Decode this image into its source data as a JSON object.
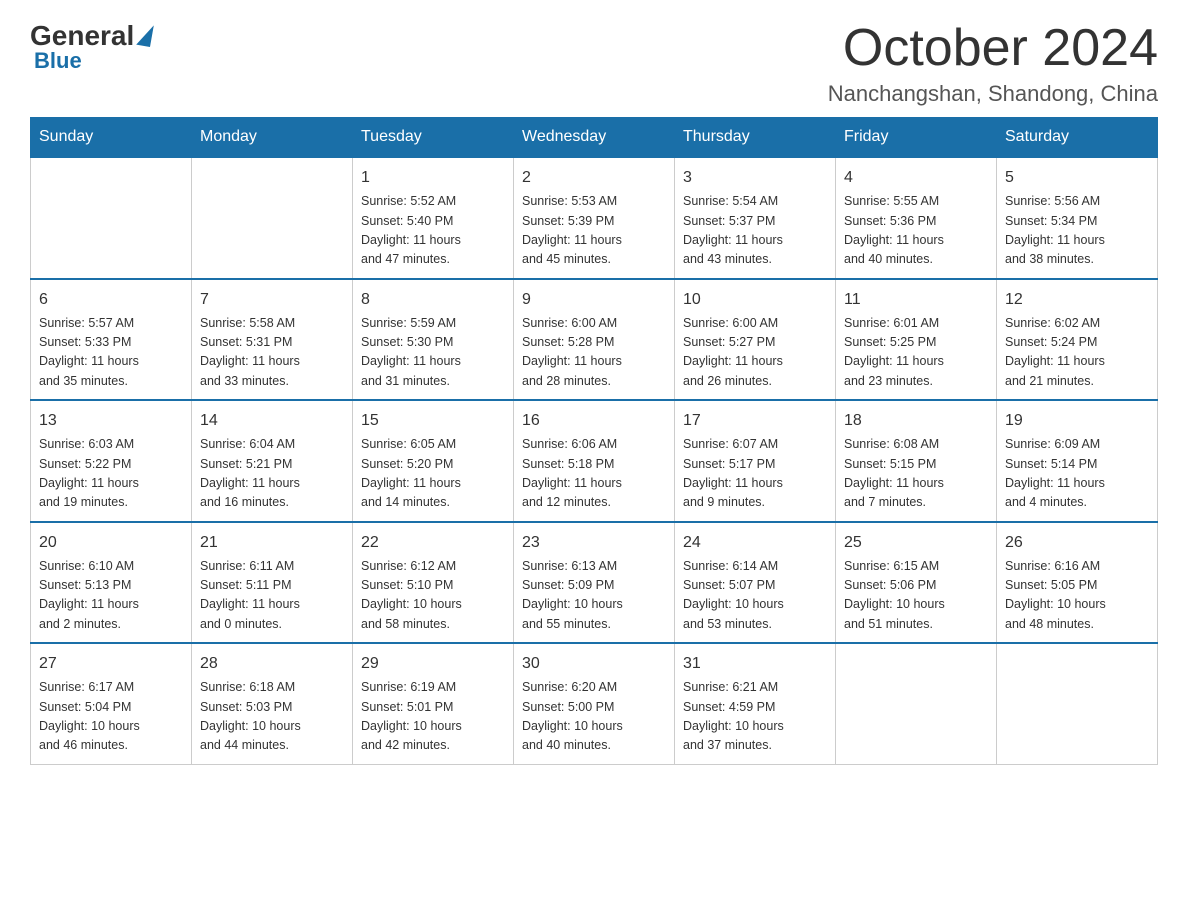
{
  "logo": {
    "general": "General",
    "blue": "Blue"
  },
  "title": "October 2024",
  "subtitle": "Nanchangshan, Shandong, China",
  "days": [
    "Sunday",
    "Monday",
    "Tuesday",
    "Wednesday",
    "Thursday",
    "Friday",
    "Saturday"
  ],
  "weeks": [
    [
      {
        "day": "",
        "info": ""
      },
      {
        "day": "",
        "info": ""
      },
      {
        "day": "1",
        "info": "Sunrise: 5:52 AM\nSunset: 5:40 PM\nDaylight: 11 hours\nand 47 minutes."
      },
      {
        "day": "2",
        "info": "Sunrise: 5:53 AM\nSunset: 5:39 PM\nDaylight: 11 hours\nand 45 minutes."
      },
      {
        "day": "3",
        "info": "Sunrise: 5:54 AM\nSunset: 5:37 PM\nDaylight: 11 hours\nand 43 minutes."
      },
      {
        "day": "4",
        "info": "Sunrise: 5:55 AM\nSunset: 5:36 PM\nDaylight: 11 hours\nand 40 minutes."
      },
      {
        "day": "5",
        "info": "Sunrise: 5:56 AM\nSunset: 5:34 PM\nDaylight: 11 hours\nand 38 minutes."
      }
    ],
    [
      {
        "day": "6",
        "info": "Sunrise: 5:57 AM\nSunset: 5:33 PM\nDaylight: 11 hours\nand 35 minutes."
      },
      {
        "day": "7",
        "info": "Sunrise: 5:58 AM\nSunset: 5:31 PM\nDaylight: 11 hours\nand 33 minutes."
      },
      {
        "day": "8",
        "info": "Sunrise: 5:59 AM\nSunset: 5:30 PM\nDaylight: 11 hours\nand 31 minutes."
      },
      {
        "day": "9",
        "info": "Sunrise: 6:00 AM\nSunset: 5:28 PM\nDaylight: 11 hours\nand 28 minutes."
      },
      {
        "day": "10",
        "info": "Sunrise: 6:00 AM\nSunset: 5:27 PM\nDaylight: 11 hours\nand 26 minutes."
      },
      {
        "day": "11",
        "info": "Sunrise: 6:01 AM\nSunset: 5:25 PM\nDaylight: 11 hours\nand 23 minutes."
      },
      {
        "day": "12",
        "info": "Sunrise: 6:02 AM\nSunset: 5:24 PM\nDaylight: 11 hours\nand 21 minutes."
      }
    ],
    [
      {
        "day": "13",
        "info": "Sunrise: 6:03 AM\nSunset: 5:22 PM\nDaylight: 11 hours\nand 19 minutes."
      },
      {
        "day": "14",
        "info": "Sunrise: 6:04 AM\nSunset: 5:21 PM\nDaylight: 11 hours\nand 16 minutes."
      },
      {
        "day": "15",
        "info": "Sunrise: 6:05 AM\nSunset: 5:20 PM\nDaylight: 11 hours\nand 14 minutes."
      },
      {
        "day": "16",
        "info": "Sunrise: 6:06 AM\nSunset: 5:18 PM\nDaylight: 11 hours\nand 12 minutes."
      },
      {
        "day": "17",
        "info": "Sunrise: 6:07 AM\nSunset: 5:17 PM\nDaylight: 11 hours\nand 9 minutes."
      },
      {
        "day": "18",
        "info": "Sunrise: 6:08 AM\nSunset: 5:15 PM\nDaylight: 11 hours\nand 7 minutes."
      },
      {
        "day": "19",
        "info": "Sunrise: 6:09 AM\nSunset: 5:14 PM\nDaylight: 11 hours\nand 4 minutes."
      }
    ],
    [
      {
        "day": "20",
        "info": "Sunrise: 6:10 AM\nSunset: 5:13 PM\nDaylight: 11 hours\nand 2 minutes."
      },
      {
        "day": "21",
        "info": "Sunrise: 6:11 AM\nSunset: 5:11 PM\nDaylight: 11 hours\nand 0 minutes."
      },
      {
        "day": "22",
        "info": "Sunrise: 6:12 AM\nSunset: 5:10 PM\nDaylight: 10 hours\nand 58 minutes."
      },
      {
        "day": "23",
        "info": "Sunrise: 6:13 AM\nSunset: 5:09 PM\nDaylight: 10 hours\nand 55 minutes."
      },
      {
        "day": "24",
        "info": "Sunrise: 6:14 AM\nSunset: 5:07 PM\nDaylight: 10 hours\nand 53 minutes."
      },
      {
        "day": "25",
        "info": "Sunrise: 6:15 AM\nSunset: 5:06 PM\nDaylight: 10 hours\nand 51 minutes."
      },
      {
        "day": "26",
        "info": "Sunrise: 6:16 AM\nSunset: 5:05 PM\nDaylight: 10 hours\nand 48 minutes."
      }
    ],
    [
      {
        "day": "27",
        "info": "Sunrise: 6:17 AM\nSunset: 5:04 PM\nDaylight: 10 hours\nand 46 minutes."
      },
      {
        "day": "28",
        "info": "Sunrise: 6:18 AM\nSunset: 5:03 PM\nDaylight: 10 hours\nand 44 minutes."
      },
      {
        "day": "29",
        "info": "Sunrise: 6:19 AM\nSunset: 5:01 PM\nDaylight: 10 hours\nand 42 minutes."
      },
      {
        "day": "30",
        "info": "Sunrise: 6:20 AM\nSunset: 5:00 PM\nDaylight: 10 hours\nand 40 minutes."
      },
      {
        "day": "31",
        "info": "Sunrise: 6:21 AM\nSunset: 4:59 PM\nDaylight: 10 hours\nand 37 minutes."
      },
      {
        "day": "",
        "info": ""
      },
      {
        "day": "",
        "info": ""
      }
    ]
  ]
}
